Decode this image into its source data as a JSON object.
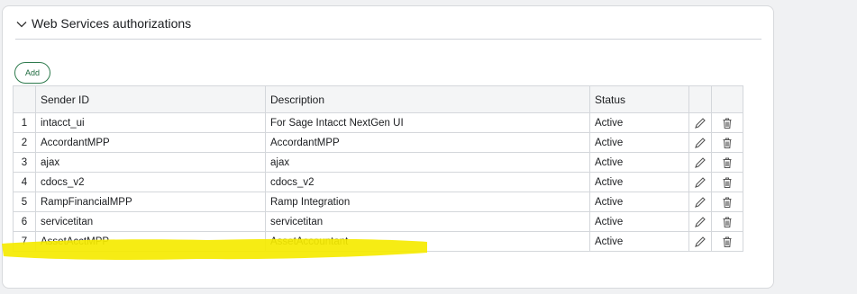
{
  "section": {
    "title": "Web Services authorizations"
  },
  "toolbar": {
    "add_label": "Add"
  },
  "table": {
    "columns": {
      "number": "",
      "sender_id": "Sender ID",
      "description": "Description",
      "status": "Status",
      "edit": "",
      "delete": ""
    },
    "rows": [
      {
        "num": "1",
        "sender_id": "intacct_ui",
        "description": "For Sage Intacct NextGen UI",
        "status": "Active"
      },
      {
        "num": "2",
        "sender_id": "AccordantMPP",
        "description": "AccordantMPP",
        "status": "Active"
      },
      {
        "num": "3",
        "sender_id": "ajax",
        "description": "ajax",
        "status": "Active"
      },
      {
        "num": "4",
        "sender_id": "cdocs_v2",
        "description": "cdocs_v2",
        "status": "Active"
      },
      {
        "num": "5",
        "sender_id": "RampFinancialMPP",
        "description": "Ramp Integration",
        "status": "Active"
      },
      {
        "num": "6",
        "sender_id": "servicetitan",
        "description": "servicetitan",
        "status": "Active"
      },
      {
        "num": "7",
        "sender_id": "AssetAcctMPP",
        "description": "AssetAccountant",
        "status": "Active"
      }
    ],
    "row_icons": {
      "edit": "pencil-icon",
      "delete": "trash-icon"
    }
  },
  "colors": {
    "accent_green": "#2f7b4e",
    "highlight_yellow": "#f5ea00"
  }
}
